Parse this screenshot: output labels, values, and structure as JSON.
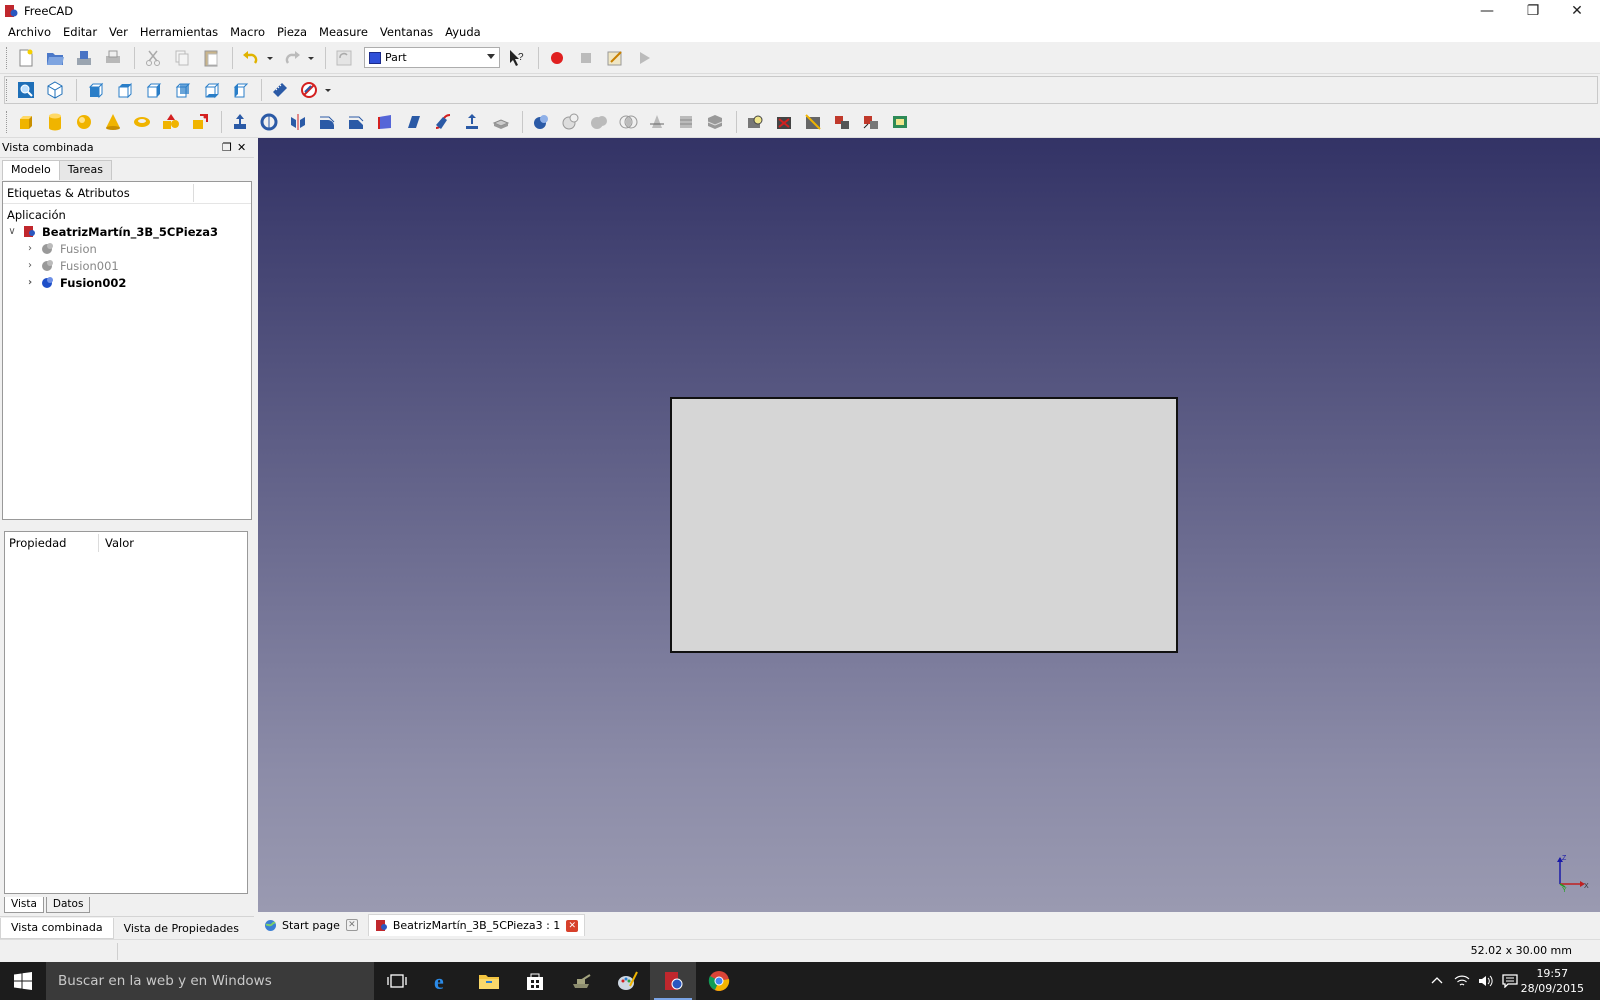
{
  "window": {
    "title": "FreeCAD"
  },
  "menu": [
    "Archivo",
    "Editar",
    "Ver",
    "Herramientas",
    "Macro",
    "Pieza",
    "Measure",
    "Ventanas",
    "Ayuda"
  ],
  "toolbar": {
    "workbench": "Part"
  },
  "panel": {
    "title": "Vista combinada",
    "tabs": [
      "Modelo",
      "Tareas"
    ],
    "tree_header": "Etiquetas & Atributos",
    "tree_root_label": "Aplicación",
    "document": "BeatrizMartín_3B_5CPieza3",
    "items": [
      {
        "label": "Fusion",
        "state": "hidden"
      },
      {
        "label": "Fusion001",
        "state": "hidden"
      },
      {
        "label": "Fusion002",
        "state": "visible"
      }
    ],
    "property_columns": [
      "Propiedad",
      "Valor"
    ],
    "property_tabs": [
      "Vista",
      "Datos"
    ],
    "dock_tabs": [
      "Vista combinada",
      "Vista de Propiedades"
    ]
  },
  "doc_tabs": [
    {
      "label": "Start page"
    },
    {
      "label": "BeatrizMartín_3B_5CPieza3 : 1"
    }
  ],
  "status": {
    "dimensions": "52.02 x 30.00 mm"
  },
  "axis": {
    "z": "Z",
    "x": "X",
    "y": "Y"
  },
  "taskbar": {
    "search_placeholder": "Buscar en la web y en Windows",
    "time": "19:57",
    "date": "28/09/2015"
  },
  "colors": {
    "viewport_top": "#333366",
    "viewport_bottom": "#9a9ab1",
    "face": "#d6d6d6"
  }
}
